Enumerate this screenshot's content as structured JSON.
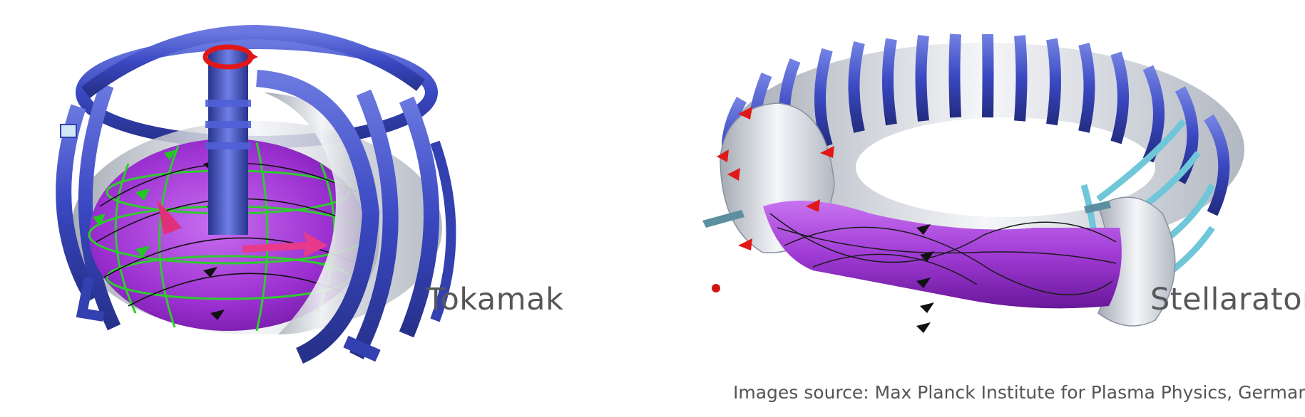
{
  "labels": {
    "tokamak": "Tokamak",
    "stellarator": "Stellarator"
  },
  "source": "Images source: Max Planck Institute for Plasma Physics, Germany",
  "colors": {
    "coil_blue": "#3f4fc8",
    "coil_dark": "#2a3590",
    "plasma_purple": "#a23cd6",
    "field_green": "#2ecc2e",
    "arrow_red": "#e01818",
    "steel_light": "#d9dde4",
    "cyan_coil": "#6fc7d9"
  },
  "icons": {
    "tokamak": "tokamak-reactor-illustration",
    "stellarator": "stellarator-reactor-illustration"
  }
}
